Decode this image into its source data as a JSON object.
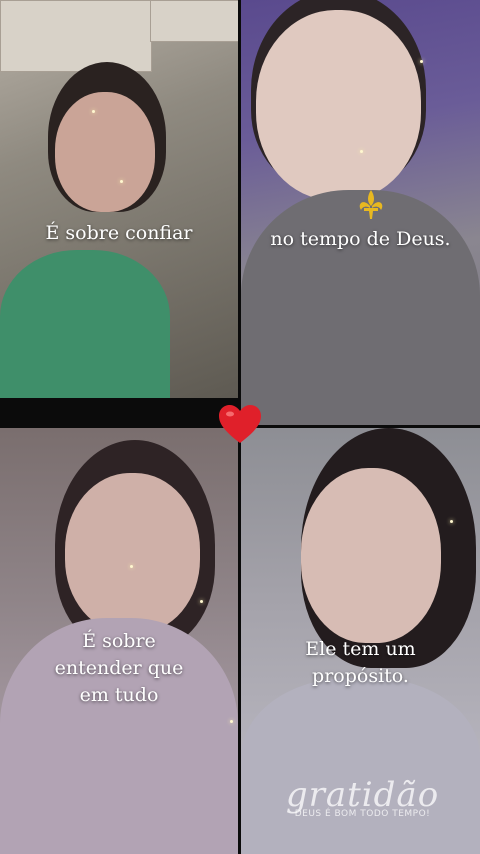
{
  "captions": {
    "top_left": "É sobre confiar",
    "top_right": "no tempo de Deus.",
    "bottom_left": [
      "É sobre",
      "entender que",
      "em tudo"
    ],
    "bottom_right": [
      "Ele tem um",
      "propósito."
    ]
  },
  "watermark": {
    "title": "gratidão",
    "subtitle": "DEUS É BOM TODO TEMPO!"
  },
  "icons": {
    "center": "heart-icon",
    "top_right": "fleur-de-lis-icon"
  },
  "colors": {
    "heart": "#e0202a",
    "fleur": "#e8b820",
    "caption": "#ffffff"
  }
}
